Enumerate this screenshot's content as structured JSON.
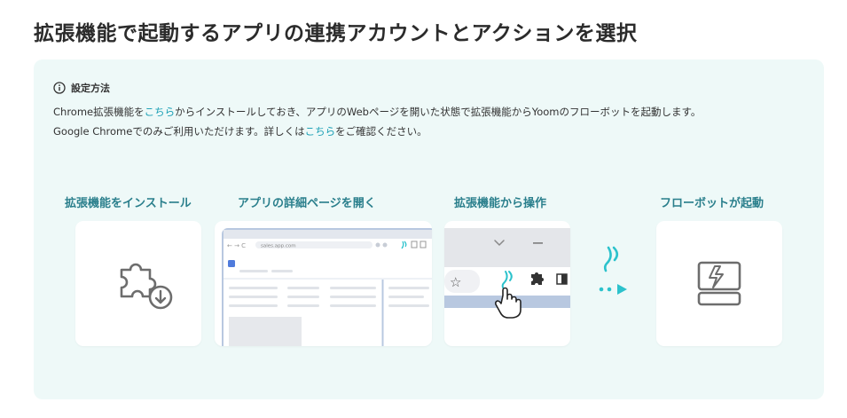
{
  "page": {
    "title": "拡張機能で起動するアプリの連携アカウントとアクションを選択"
  },
  "setup": {
    "heading": "設定方法",
    "line1_before": "Chrome拡張機能を",
    "line1_link": "こちら",
    "line1_after": "からインストールしておき、アプリのWebページを開いた状態で拡張機能からYoomのフローボットを起動します。",
    "line2_before": "Google Chromeでのみご利用いただけます。詳しくは",
    "line2_link": "こちら",
    "line2_after": "をご確認ください。"
  },
  "steps": [
    {
      "label": "拡張機能をインストール",
      "icon": "puzzle-download-icon"
    },
    {
      "label": "アプリの詳細ページを開く",
      "icon": "browser-page-illustration"
    },
    {
      "label": "拡張機能から操作",
      "icon": "extension-toolbar-illustration"
    },
    {
      "label": "フローボットが起動",
      "icon": "flowbot-launch-icon"
    }
  ],
  "browser_mock": {
    "url": "sales.app.com"
  },
  "colors": {
    "accent": "#1a9fb5",
    "accent_icon": "#2cc2cc",
    "step_label": "#2a7f8c",
    "panel_bg": "#eef9f8",
    "browser_frame": "#b8c8e0"
  }
}
